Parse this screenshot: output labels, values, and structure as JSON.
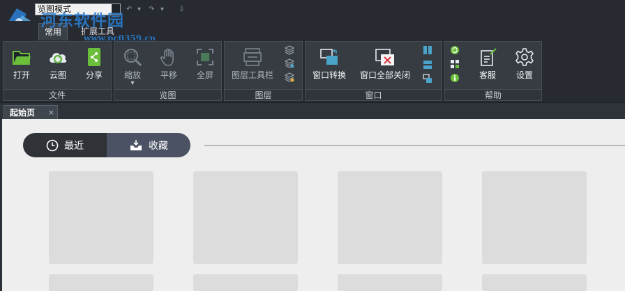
{
  "quick_access": {
    "mode_select": "览图模式",
    "undo_glyph": "↶",
    "redo_glyph": "↷",
    "dropdown_glyph": "▾",
    "customize_glyph": "⇩"
  },
  "watermark": {
    "text": "河东软件园",
    "url": "www.pc0359.cn"
  },
  "ribbon_tabs": [
    {
      "label": "常用",
      "active": true
    },
    {
      "label": "扩展工具",
      "active": false
    }
  ],
  "groups": {
    "file": {
      "label": "文件",
      "buttons": [
        {
          "label": "打开",
          "icon": "folder-open-icon"
        },
        {
          "label": "云图",
          "icon": "cloud-sync-icon"
        },
        {
          "label": "分享",
          "icon": "share-icon"
        }
      ]
    },
    "view": {
      "label": "览图",
      "buttons": [
        {
          "label": "缩放",
          "icon": "zoom-icon"
        },
        {
          "label": "平移",
          "icon": "pan-hand-icon"
        },
        {
          "label": "全屏",
          "icon": "fullscreen-icon"
        }
      ],
      "zoom_dropdown": "▾"
    },
    "layer": {
      "label": "图层",
      "buttons": [
        {
          "label": "图层工具栏",
          "icon": "layer-toolbar-icon"
        }
      ]
    },
    "window": {
      "label": "窗口",
      "buttons": [
        {
          "label": "窗口转换",
          "icon": "window-switch-icon"
        },
        {
          "label": "窗口全部关闭",
          "icon": "close-all-windows-icon"
        }
      ]
    },
    "help": {
      "label": "帮助",
      "buttons": [
        {
          "label": "客服",
          "icon": "customer-service-icon"
        },
        {
          "label": "设置",
          "icon": "settings-gear-icon"
        }
      ]
    }
  },
  "doc_tab": {
    "label": "起始页",
    "close": "×"
  },
  "start_page": {
    "tabs": [
      {
        "label": "最近",
        "icon": "clock-icon",
        "active": true
      },
      {
        "label": "收藏",
        "icon": "inbox-download-icon",
        "active": false
      }
    ]
  },
  "colors": {
    "ribbon_bg": "#373c43",
    "content_bg": "#eeeeee",
    "accent_green": "#6bbf3a",
    "accent_blue": "#4aa3c8",
    "close_red": "#d9333c"
  }
}
